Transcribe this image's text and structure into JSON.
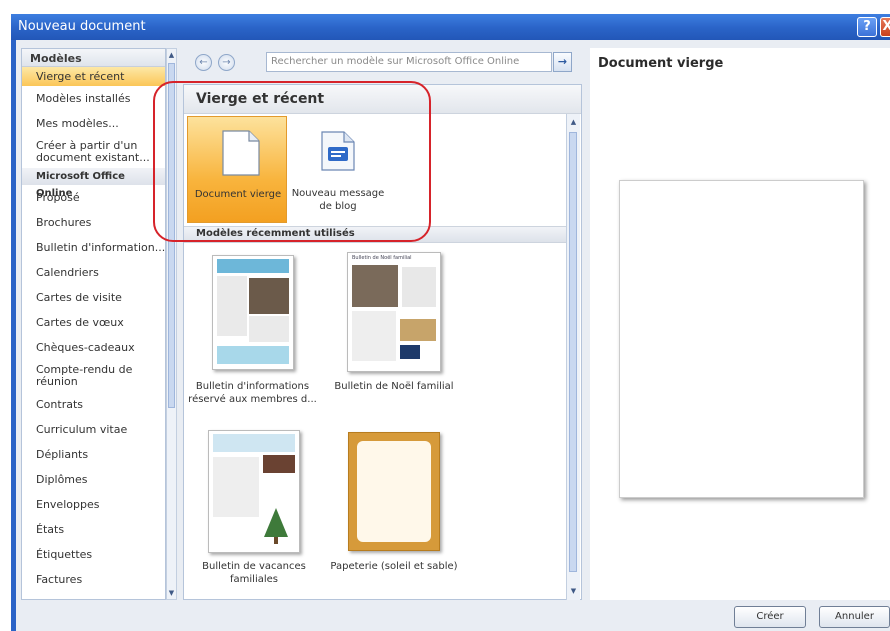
{
  "window": {
    "title": "Nouveau document",
    "help": "?",
    "close": "X"
  },
  "sidebar": {
    "header": "Modèles",
    "items": [
      {
        "label": "Vierge et récent",
        "selected": true
      },
      {
        "label": "Modèles installés"
      },
      {
        "label": "Mes modèles..."
      },
      {
        "label": "Créer à partir d'un document existant..."
      }
    ],
    "group": "Microsoft Office Online",
    "online_items": [
      "Proposé",
      "Brochures",
      "Bulletin d'information...",
      "Calendriers",
      "Cartes de visite",
      "Cartes de vœux",
      "Chèques-cadeaux",
      "Compte-rendu de réunion",
      "Contrats",
      "Curriculum vitae",
      "Dépliants",
      "Diplômes",
      "Enveloppes",
      "États",
      "Étiquettes",
      "Factures"
    ]
  },
  "toolbar": {
    "back": "←",
    "forward": "→",
    "search_placeholder": "Rechercher un modèle sur Microsoft Office Online",
    "go": "→"
  },
  "center": {
    "title": "Vierge et récent",
    "tiles": [
      {
        "label": "Document vierge",
        "selected": true
      },
      {
        "label": "Nouveau message de blog"
      }
    ],
    "recent_header": "Modèles récemment utilisés",
    "recent": [
      {
        "label": "Bulletin d'informations réservé aux membres d..."
      },
      {
        "label": "Bulletin de Noël familial",
        "header_text": "Bulletin de Noël familial"
      },
      {
        "label": "Bulletin de vacances familiales"
      },
      {
        "label": "Papeterie (soleil et sable)"
      }
    ]
  },
  "preview": {
    "title": "Document vierge"
  },
  "buttons": {
    "create": "Créer",
    "cancel": "Annuler"
  },
  "colors": {
    "titlebar": "#2a63c7",
    "selection": "#fbc658",
    "annotation": "#d6232a"
  }
}
